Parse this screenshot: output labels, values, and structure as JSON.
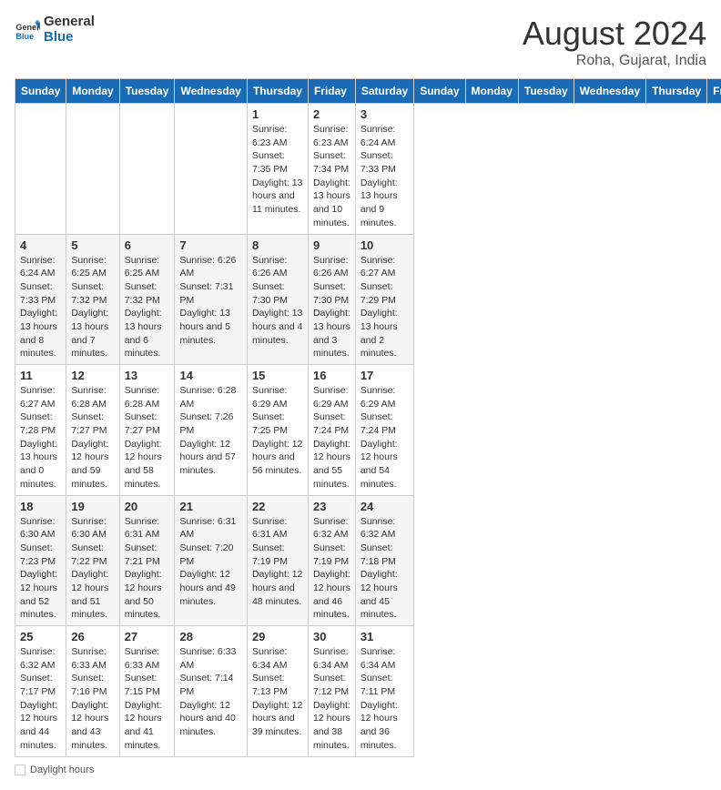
{
  "header": {
    "logo_line1": "General",
    "logo_line2": "Blue",
    "month_year": "August 2024",
    "location": "Roha, Gujarat, India"
  },
  "days_of_week": [
    "Sunday",
    "Monday",
    "Tuesday",
    "Wednesday",
    "Thursday",
    "Friday",
    "Saturday"
  ],
  "weeks": [
    [
      {
        "day": "",
        "info": ""
      },
      {
        "day": "",
        "info": ""
      },
      {
        "day": "",
        "info": ""
      },
      {
        "day": "",
        "info": ""
      },
      {
        "day": "1",
        "sunrise": "6:23 AM",
        "sunset": "7:35 PM",
        "daylight": "13 hours and 11 minutes."
      },
      {
        "day": "2",
        "sunrise": "6:23 AM",
        "sunset": "7:34 PM",
        "daylight": "13 hours and 10 minutes."
      },
      {
        "day": "3",
        "sunrise": "6:24 AM",
        "sunset": "7:33 PM",
        "daylight": "13 hours and 9 minutes."
      }
    ],
    [
      {
        "day": "4",
        "sunrise": "6:24 AM",
        "sunset": "7:33 PM",
        "daylight": "13 hours and 8 minutes."
      },
      {
        "day": "5",
        "sunrise": "6:25 AM",
        "sunset": "7:32 PM",
        "daylight": "13 hours and 7 minutes."
      },
      {
        "day": "6",
        "sunrise": "6:25 AM",
        "sunset": "7:32 PM",
        "daylight": "13 hours and 6 minutes."
      },
      {
        "day": "7",
        "sunrise": "6:26 AM",
        "sunset": "7:31 PM",
        "daylight": "13 hours and 5 minutes."
      },
      {
        "day": "8",
        "sunrise": "6:26 AM",
        "sunset": "7:30 PM",
        "daylight": "13 hours and 4 minutes."
      },
      {
        "day": "9",
        "sunrise": "6:26 AM",
        "sunset": "7:30 PM",
        "daylight": "13 hours and 3 minutes."
      },
      {
        "day": "10",
        "sunrise": "6:27 AM",
        "sunset": "7:29 PM",
        "daylight": "13 hours and 2 minutes."
      }
    ],
    [
      {
        "day": "11",
        "sunrise": "6:27 AM",
        "sunset": "7:28 PM",
        "daylight": "13 hours and 0 minutes."
      },
      {
        "day": "12",
        "sunrise": "6:28 AM",
        "sunset": "7:27 PM",
        "daylight": "12 hours and 59 minutes."
      },
      {
        "day": "13",
        "sunrise": "6:28 AM",
        "sunset": "7:27 PM",
        "daylight": "12 hours and 58 minutes."
      },
      {
        "day": "14",
        "sunrise": "6:28 AM",
        "sunset": "7:26 PM",
        "daylight": "12 hours and 57 minutes."
      },
      {
        "day": "15",
        "sunrise": "6:29 AM",
        "sunset": "7:25 PM",
        "daylight": "12 hours and 56 minutes."
      },
      {
        "day": "16",
        "sunrise": "6:29 AM",
        "sunset": "7:24 PM",
        "daylight": "12 hours and 55 minutes."
      },
      {
        "day": "17",
        "sunrise": "6:29 AM",
        "sunset": "7:24 PM",
        "daylight": "12 hours and 54 minutes."
      }
    ],
    [
      {
        "day": "18",
        "sunrise": "6:30 AM",
        "sunset": "7:23 PM",
        "daylight": "12 hours and 52 minutes."
      },
      {
        "day": "19",
        "sunrise": "6:30 AM",
        "sunset": "7:22 PM",
        "daylight": "12 hours and 51 minutes."
      },
      {
        "day": "20",
        "sunrise": "6:31 AM",
        "sunset": "7:21 PM",
        "daylight": "12 hours and 50 minutes."
      },
      {
        "day": "21",
        "sunrise": "6:31 AM",
        "sunset": "7:20 PM",
        "daylight": "12 hours and 49 minutes."
      },
      {
        "day": "22",
        "sunrise": "6:31 AM",
        "sunset": "7:19 PM",
        "daylight": "12 hours and 48 minutes."
      },
      {
        "day": "23",
        "sunrise": "6:32 AM",
        "sunset": "7:19 PM",
        "daylight": "12 hours and 46 minutes."
      },
      {
        "day": "24",
        "sunrise": "6:32 AM",
        "sunset": "7:18 PM",
        "daylight": "12 hours and 45 minutes."
      }
    ],
    [
      {
        "day": "25",
        "sunrise": "6:32 AM",
        "sunset": "7:17 PM",
        "daylight": "12 hours and 44 minutes."
      },
      {
        "day": "26",
        "sunrise": "6:33 AM",
        "sunset": "7:16 PM",
        "daylight": "12 hours and 43 minutes."
      },
      {
        "day": "27",
        "sunrise": "6:33 AM",
        "sunset": "7:15 PM",
        "daylight": "12 hours and 41 minutes."
      },
      {
        "day": "28",
        "sunrise": "6:33 AM",
        "sunset": "7:14 PM",
        "daylight": "12 hours and 40 minutes."
      },
      {
        "day": "29",
        "sunrise": "6:34 AM",
        "sunset": "7:13 PM",
        "daylight": "12 hours and 39 minutes."
      },
      {
        "day": "30",
        "sunrise": "6:34 AM",
        "sunset": "7:12 PM",
        "daylight": "12 hours and 38 minutes."
      },
      {
        "day": "31",
        "sunrise": "6:34 AM",
        "sunset": "7:11 PM",
        "daylight": "12 hours and 36 minutes."
      }
    ]
  ],
  "footer": {
    "daylight_label": "Daylight hours"
  }
}
